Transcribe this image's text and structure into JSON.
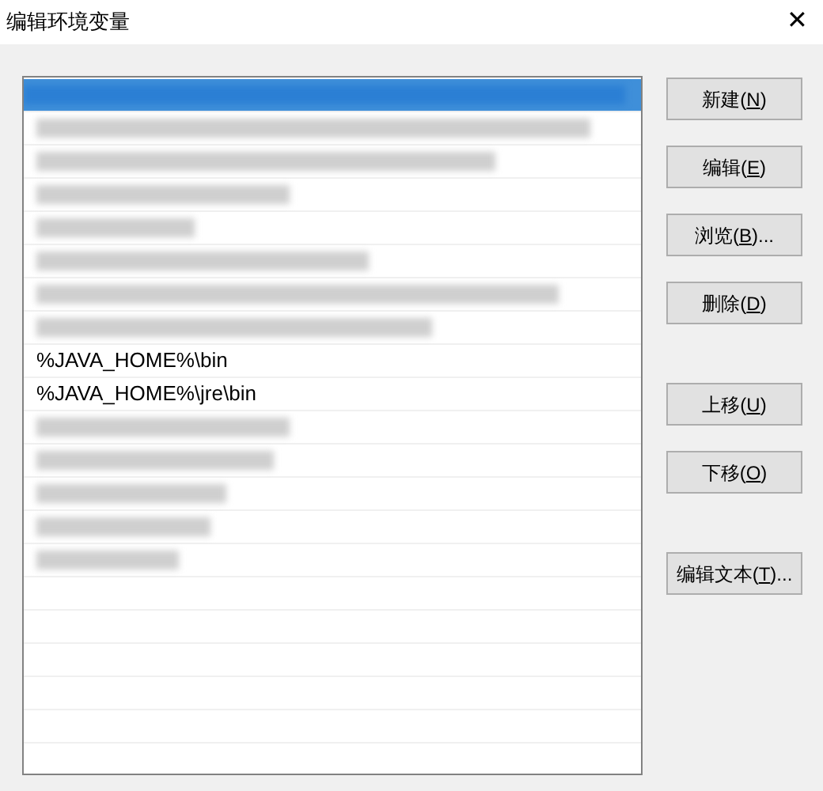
{
  "window": {
    "title": "编辑环境变量",
    "close": "✕"
  },
  "list": {
    "items": [
      {
        "kind": "redacted",
        "selected": true
      },
      {
        "kind": "redacted",
        "selected": false
      },
      {
        "kind": "redacted",
        "selected": false
      },
      {
        "kind": "redacted",
        "selected": false
      },
      {
        "kind": "redacted",
        "selected": false
      },
      {
        "kind": "redacted",
        "selected": false
      },
      {
        "kind": "redacted",
        "selected": false
      },
      {
        "kind": "redacted",
        "selected": false
      },
      {
        "kind": "text",
        "text": "%JAVA_HOME%\\bin",
        "selected": false
      },
      {
        "kind": "text",
        "text": "%JAVA_HOME%\\jre\\bin",
        "selected": false
      },
      {
        "kind": "redacted",
        "selected": false
      },
      {
        "kind": "redacted",
        "selected": false
      },
      {
        "kind": "redacted",
        "selected": false
      },
      {
        "kind": "redacted",
        "selected": false
      },
      {
        "kind": "redacted",
        "selected": false
      },
      {
        "kind": "empty"
      },
      {
        "kind": "empty"
      },
      {
        "kind": "empty"
      },
      {
        "kind": "empty"
      },
      {
        "kind": "empty"
      },
      {
        "kind": "empty"
      }
    ]
  },
  "button_groups": [
    [
      {
        "before": "新建(",
        "key": "N",
        "after": ")"
      },
      {
        "before": "编辑(",
        "key": "E",
        "after": ")"
      },
      {
        "before": "浏览(",
        "key": "B",
        "after": ")..."
      },
      {
        "before": "删除(",
        "key": "D",
        "after": ")"
      }
    ],
    [
      {
        "before": "上移(",
        "key": "U",
        "after": ")"
      },
      {
        "before": "下移(",
        "key": "O",
        "after": ")"
      }
    ],
    [
      {
        "before": "编辑文本(",
        "key": "T",
        "after": ")..."
      }
    ]
  ]
}
